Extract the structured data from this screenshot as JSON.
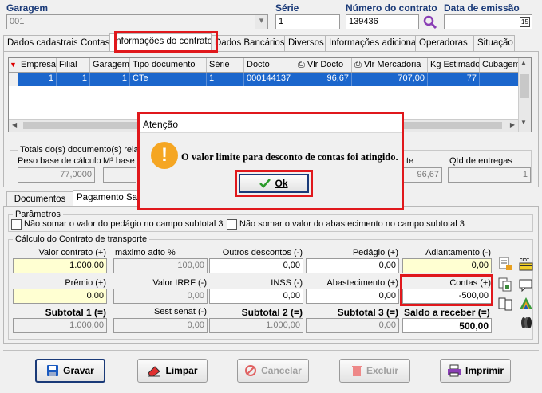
{
  "header": {
    "garagem_label": "Garagem",
    "garagem_value": "001",
    "serie_label": "Série",
    "serie_value": "1",
    "numero_label": "Número do contrato",
    "numero_value": "139436",
    "data_label": "Data de emissão",
    "data_value": ""
  },
  "tabs": [
    {
      "label": "Dados cadastrais"
    },
    {
      "label": "Contas"
    },
    {
      "label": "Informações do contrato"
    },
    {
      "label": "Dados Bancários"
    },
    {
      "label": "Diversos"
    },
    {
      "label": "Informações adicionais"
    },
    {
      "label": "Operadoras"
    },
    {
      "label": "Situação"
    }
  ],
  "grid": {
    "columns": [
      "Empresa",
      "Filial",
      "Garagem",
      "Tipo documento",
      "Série",
      "Docto",
      "Vlr Docto",
      "Vlr Mercadoria",
      "Kg Estimado",
      "Cubagem"
    ],
    "row": [
      "1",
      "1",
      "1",
      "CTe",
      "1",
      "000144137",
      "96,67",
      "707,00",
      "77",
      ""
    ]
  },
  "totais": {
    "label": "Totais do(s) documento(s) relac",
    "peso_label": "Peso base de cálculo",
    "peso_value": "77,0000",
    "m3_label": "M³ base c",
    "vlr_label": "te",
    "vlr_value": "96,67",
    "qtd_label": "Qtd de entregas",
    "qtd_value": "1"
  },
  "subtabs": [
    {
      "label": "Documentos"
    },
    {
      "label": "Pagamento Sa"
    }
  ],
  "parametros": {
    "label": "Parâmetros",
    "check1": "Não somar o valor do pedágio no campo subtotal 3",
    "check2": "Não somar o valor do abastecimento no campo subtotal 3"
  },
  "calculo": {
    "label": "Cálculo do Contrato de transporte",
    "row1": [
      {
        "label": "Valor contrato (+)",
        "value": "1.000,00"
      },
      {
        "label": "máximo adto %",
        "value": "100,00"
      },
      {
        "label": "Outros descontos (-)",
        "value": "0,00"
      },
      {
        "label": "Pedágio (+)",
        "value": "0,00"
      },
      {
        "label": "Adiantamento (-)",
        "value": "0,00"
      }
    ],
    "row2": [
      {
        "label": "Prêmio (+)",
        "value": "0,00"
      },
      {
        "label": "Valor IRRF (-)",
        "value": "0,00"
      },
      {
        "label": "INSS (-)",
        "value": "0,00"
      },
      {
        "label": "Abastecimento (+)",
        "value": "0,00"
      },
      {
        "label": "Contas (+)",
        "value": "-500,00"
      }
    ],
    "row3": [
      {
        "label": "Subtotal 1 (=)",
        "value": "1.000,00"
      },
      {
        "label": "Sest senat (-)",
        "value": "0,00"
      },
      {
        "label": "Subtotal 2 (=)",
        "value": "1.000,00"
      },
      {
        "label": "Subtotal 3 (=)",
        "value": "0,00"
      },
      {
        "label": "Saldo a receber (=)",
        "value": "500,00"
      }
    ]
  },
  "dialog": {
    "title": "Atenção",
    "message": "O valor limite para desconto de contas foi atingido.",
    "ok_label": "Ok"
  },
  "buttons": {
    "gravar": "Gravar",
    "limpar": "Limpar",
    "cancelar": "Cancelar",
    "excluir": "Excluir",
    "imprimir": "Imprimir"
  },
  "colors": {
    "highlight": "#e0181c",
    "selection": "#1b66cc",
    "label_blue": "#1a3a78",
    "warning": "#f5a623"
  }
}
